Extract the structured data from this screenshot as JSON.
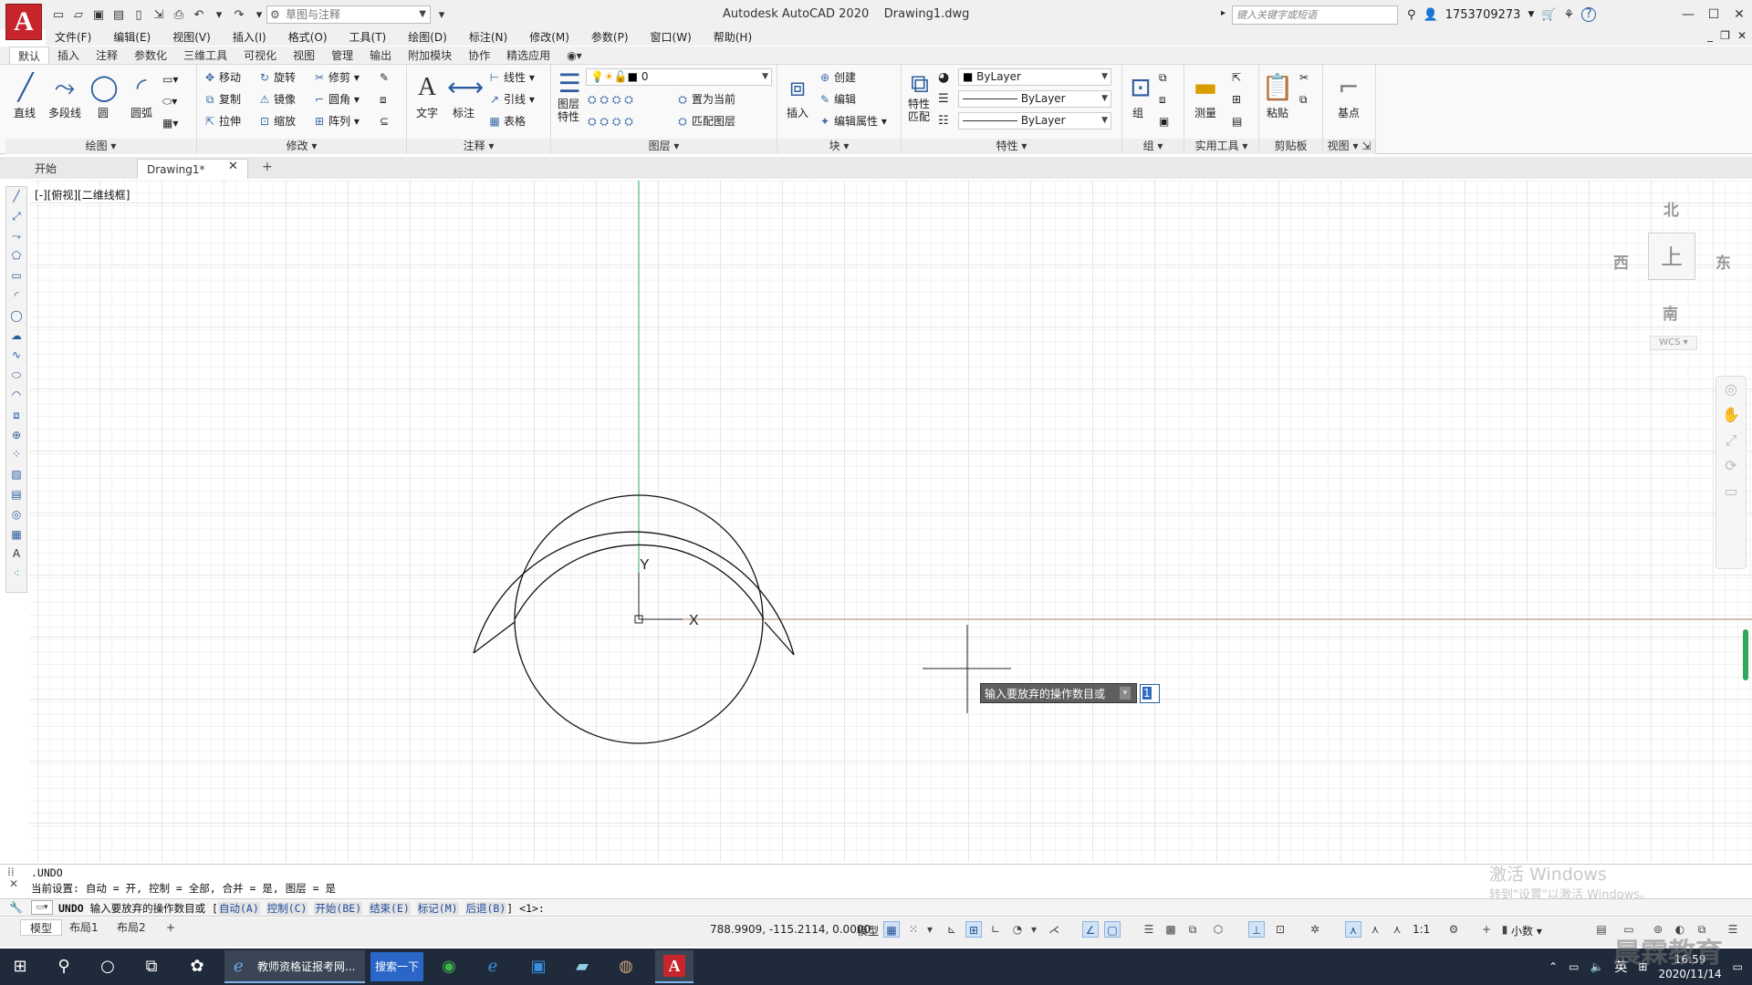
{
  "app": {
    "title": "Autodesk AutoCAD 2020    Drawing1.dwg",
    "logo": "A",
    "workspace": "草图与注释",
    "search_placeholder": "键入关键字或短语",
    "username": "1753709273"
  },
  "menus": [
    "文件(F)",
    "编辑(E)",
    "视图(V)",
    "插入(I)",
    "格式(O)",
    "工具(T)",
    "绘图(D)",
    "标注(N)",
    "修改(M)",
    "参数(P)",
    "窗口(W)",
    "帮助(H)"
  ],
  "ribbon_tabs": [
    "默认",
    "插入",
    "注释",
    "参数化",
    "三维工具",
    "可视化",
    "视图",
    "管理",
    "输出",
    "附加模块",
    "协作",
    "精选应用"
  ],
  "ribbon": {
    "draw": {
      "title": "绘图",
      "line": "直线",
      "polyline": "多段线",
      "circle": "圆",
      "arc": "圆弧"
    },
    "modify": {
      "title": "修改",
      "move": "移动",
      "rotate": "旋转",
      "trim": "修剪",
      "copy": "复制",
      "mirror": "镜像",
      "fillet": "圆角",
      "stretch": "拉伸",
      "scale": "缩放",
      "array": "阵列"
    },
    "annotation": {
      "title": "注释",
      "text": "文字",
      "dimension": "标注",
      "linear": "线性",
      "leader": "引线",
      "table": "表格"
    },
    "layers": {
      "title": "图层",
      "layer_props": "图层\n特性",
      "current_layer": "0",
      "set_current": "置为当前",
      "match_layer": "匹配图层"
    },
    "block": {
      "title": "块",
      "insert": "插入",
      "create": "创建",
      "edit": "编辑",
      "edit_attr": "编辑属性"
    },
    "properties": {
      "title": "特性",
      "match": "特性\n匹配",
      "color": "ByLayer",
      "linetype": "ByLayer",
      "lineweight": "ByLayer"
    },
    "groups": {
      "title": "组",
      "group": "组"
    },
    "utilities": {
      "title": "实用工具",
      "measure": "测量"
    },
    "clipboard": {
      "title": "剪贴板",
      "paste": "粘贴"
    },
    "view": {
      "title": "视图",
      "base": "基点"
    }
  },
  "file_tabs": [
    "开始",
    "Drawing1*"
  ],
  "viewport_label": "[-][俯视][二维线框]",
  "viewcube": {
    "north": "北",
    "south": "南",
    "east": "东",
    "west": "西",
    "top": "上",
    "wcs": "WCS"
  },
  "axes": {
    "x": "X",
    "y": "Y"
  },
  "dynamic_input": {
    "prompt": "输入要放弃的操作数目或",
    "value": "1"
  },
  "command": {
    "history": [
      ".UNDO",
      "当前设置: 自动 = 开, 控制 = 全部, 合并 = 是, 图层 = 是"
    ],
    "input_cmd": "UNDO",
    "input_text": " 输入要放弃的操作数目或 [",
    "options": [
      "自动(A)",
      "控制(C)",
      "开始(BE)",
      "结束(E)",
      "标记(M)",
      "后退(B)"
    ],
    "suffix": "] <1>:"
  },
  "layout_tabs": [
    "模型",
    "布局1",
    "布局2"
  ],
  "status": {
    "coords": "788.9909, -115.2114, 0.0000",
    "model": "模型",
    "scale": "1:1",
    "units": "小数"
  },
  "watermark": {
    "title": "激活 Windows",
    "subtitle": "转到\"设置\"以激活 Windows。",
    "corner": "晨霖教育"
  },
  "taskbar": {
    "ie_label": "教师资格证报考网...",
    "search_btn": "搜索一下",
    "ime": "英",
    "time": "16:59",
    "date": "2020/11/14"
  },
  "colors": {
    "accent": "#c8242b",
    "y_axis": "#2fa85d",
    "x_axis": "#b08060",
    "grid": "#d8d8d8",
    "taskbar": "#1f2a3a"
  }
}
